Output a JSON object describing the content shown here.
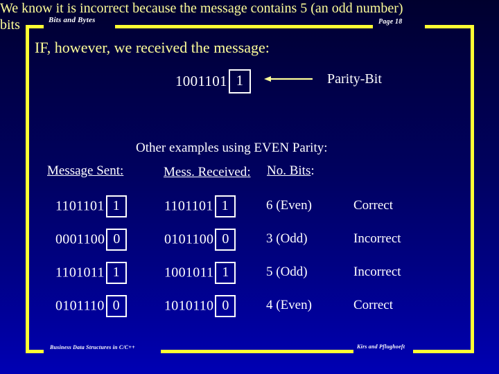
{
  "slide": {
    "header_left": "Bits and Bytes",
    "header_right": "Page 18",
    "footer_left": "Business Data Structures in C/C++",
    "footer_right": "Kirs and Pflughoeft",
    "intro": "IF, however, we received the message:",
    "explanation": "We know it is incorrect because the message contains 5 (an odd number) bits",
    "other_examples": "Other examples using EVEN Parity:"
  },
  "example": {
    "message_bits": "1001101",
    "parity_bit": "1",
    "arrow_icon": "left-arrow-icon",
    "callout_label": "Parity-Bit"
  },
  "table": {
    "headers": [
      {
        "label": "Message Sent",
        "colon": ":"
      },
      {
        "label": "Mess. Received",
        "colon": ":"
      },
      {
        "label": "No. Bits",
        "colon": ":"
      }
    ],
    "rows": [
      {
        "sent_bits": "1101101",
        "sent_parity": "1",
        "received_bits": "1101101",
        "received_parity": "1",
        "count": "6 (Even)",
        "status": "Correct"
      },
      {
        "sent_bits": "0001100",
        "sent_parity": "0",
        "received_bits": "0101100",
        "received_parity": "0",
        "count": "3 (Odd)",
        "status": "Incorrect"
      },
      {
        "sent_bits": "1101011",
        "sent_parity": "1",
        "received_bits": "1001011",
        "received_parity": "1",
        "count": "5 (Odd)",
        "status": "Incorrect"
      },
      {
        "sent_bits": "0101110",
        "sent_parity": "0",
        "received_bits": "1010110",
        "received_parity": "0",
        "count": "4 (Even)",
        "status": "Correct"
      }
    ]
  },
  "colors": {
    "frame": "#ffff33",
    "accent_text": "#ffff99",
    "primary_text": "#ffffff",
    "background_top": "#00002e",
    "background_bottom": "#0000b4"
  }
}
